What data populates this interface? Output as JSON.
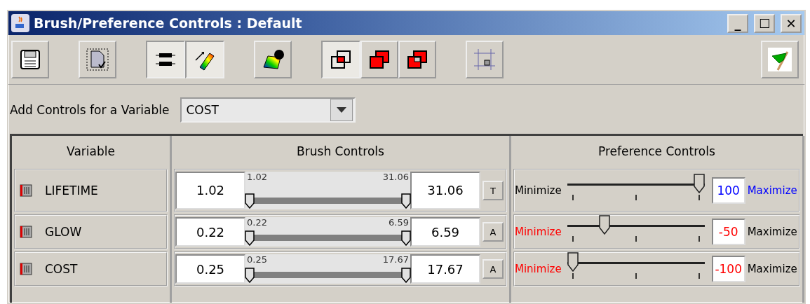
{
  "window": {
    "title": "Brush/Preference Controls : Default",
    "controls": [
      "_",
      "☐",
      "✕"
    ]
  },
  "toolbar": {
    "groups": [
      [
        {
          "kind": "save",
          "selected": false
        }
      ],
      [
        {
          "kind": "document",
          "selected": false
        }
      ],
      [
        {
          "kind": "sliders",
          "selected": true
        },
        {
          "kind": "brush",
          "selected": true
        }
      ],
      [
        {
          "kind": "palette",
          "selected": false
        }
      ],
      [
        {
          "kind": "overlap-and",
          "selected": true
        },
        {
          "kind": "overlap-or",
          "selected": false
        },
        {
          "kind": "overlap-xor",
          "selected": false
        }
      ],
      [
        {
          "kind": "frame",
          "selected": false
        }
      ]
    ],
    "end": [
      {
        "kind": "flag",
        "selected": false
      }
    ]
  },
  "add_controls": {
    "label": "Add Controls for a Variable",
    "value": "COST"
  },
  "table": {
    "columns": [
      "Variable",
      "Brush Controls",
      "Preference Controls"
    ],
    "rows": [
      {
        "variable": "LIFETIME",
        "min": "1.02",
        "max": "31.06",
        "min_label": "1.02",
        "max_label": "31.06",
        "thumbs": [
          {
            "level": 0
          },
          {
            "level": 1
          }
        ],
        "button": "T",
        "min_text": "Minimize",
        "min_highlighted": false,
        "value": "100",
        "max_text": "Maximize",
        "max_highlighted": true,
        "level": 1
      },
      {
        "variable": "GLOW",
        "min": "0.22",
        "max": "6.59",
        "min_label": "0.22",
        "max_label": "6.59",
        "thumbs": [
          {
            "level": 0
          },
          {
            "level": 1
          }
        ],
        "button": "A",
        "min_text": "Minimize",
        "min_highlighted": true,
        "value": "-50",
        "max_text": "Maximize",
        "max_highlighted": false,
        "level": 0.25
      },
      {
        "variable": "COST",
        "min": "0.25",
        "max": "17.67",
        "min_label": "0.25",
        "max_label": "17.67",
        "thumbs": [
          {
            "level": 0
          },
          {
            "level": 1
          }
        ],
        "button": "A",
        "min_text": "Minimize",
        "min_highlighted": true,
        "value": "-100",
        "max_text": "Maximize",
        "max_highlighted": false,
        "level": 0
      }
    ]
  }
}
